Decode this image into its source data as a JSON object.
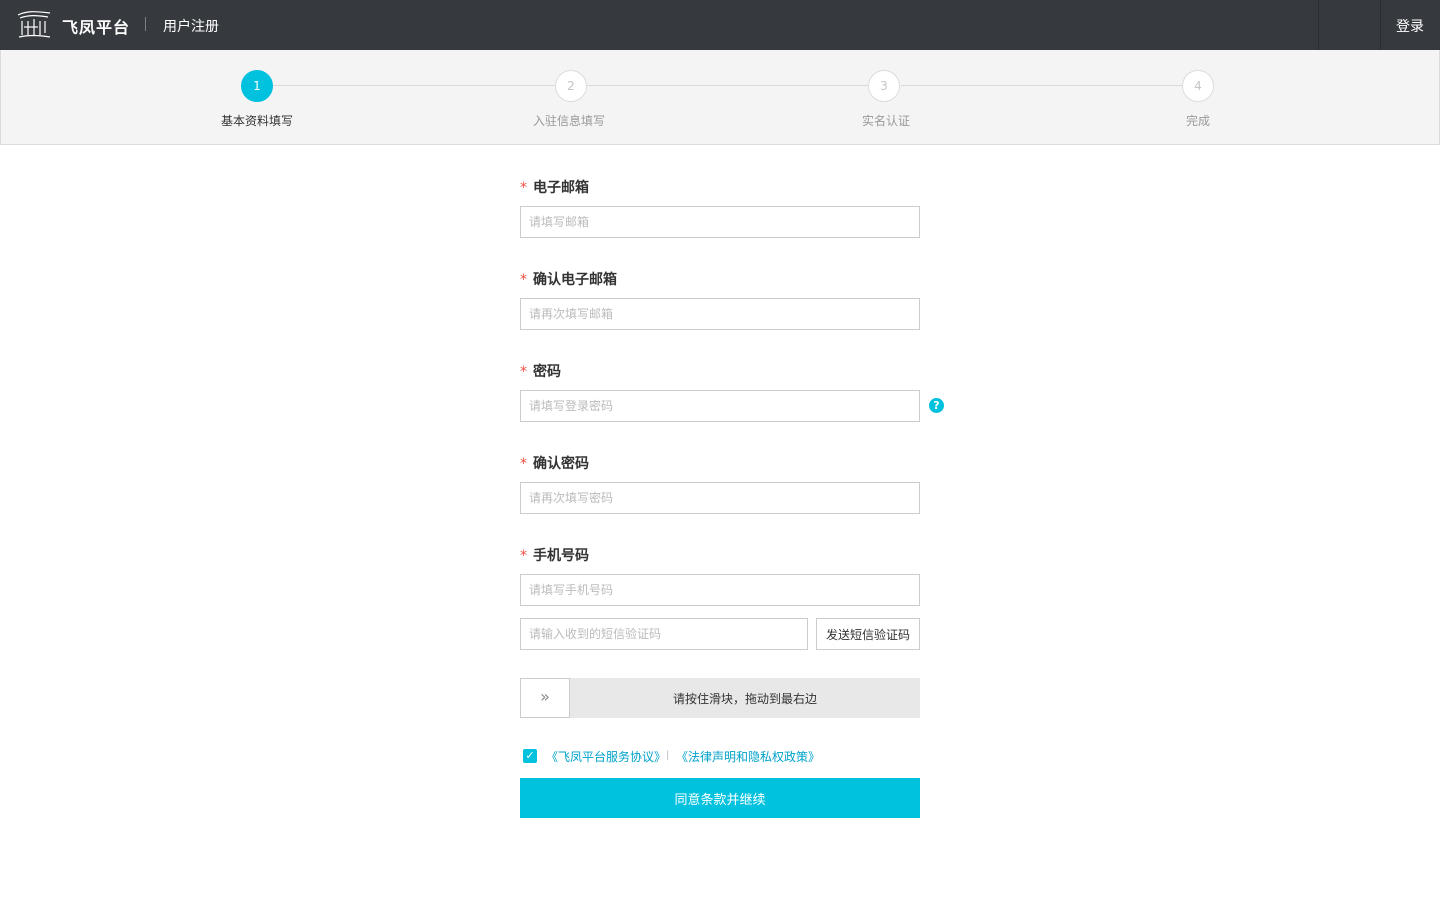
{
  "header": {
    "brand": "飞凤平台",
    "page_name": "用户注册",
    "login_label": "登录"
  },
  "steps": [
    {
      "number": "1",
      "label": "基本资料填写",
      "active": true
    },
    {
      "number": "2",
      "label": "入驻信息填写",
      "active": false
    },
    {
      "number": "3",
      "label": "实名认证",
      "active": false
    },
    {
      "number": "4",
      "label": "完成",
      "active": false
    }
  ],
  "form": {
    "required_mark": "*",
    "email": {
      "label": "电子邮箱",
      "placeholder": "请填写邮箱",
      "value": ""
    },
    "email_confirm": {
      "label": "确认电子邮箱",
      "placeholder": "请再次填写邮箱",
      "value": ""
    },
    "password": {
      "label": "密码",
      "placeholder": "请填写登录密码",
      "value": "",
      "help": "?"
    },
    "password_confirm": {
      "label": "确认密码",
      "placeholder": "请再次填写密码",
      "value": ""
    },
    "phone": {
      "label": "手机号码",
      "placeholder": "请填写手机号码",
      "value": ""
    },
    "sms_code": {
      "placeholder": "请输入收到的短信验证码",
      "value": "",
      "button_label": "发送短信验证码"
    },
    "slider": {
      "handle_glyph": "»",
      "text": "请按住滑块，拖动到最右边",
      "progress": 0
    },
    "agreement": {
      "checked": true,
      "check_glyph": "✓",
      "link1": "《飞凤平台服务协议》",
      "separator": "|",
      "link2": "《法律声明和隐私权政策》"
    },
    "submit_label": "同意条款并继续"
  },
  "colors": {
    "header_bg": "#363a3f",
    "accent": "#00c1de",
    "link": "#00a2ca",
    "required": "#f04d3d"
  }
}
